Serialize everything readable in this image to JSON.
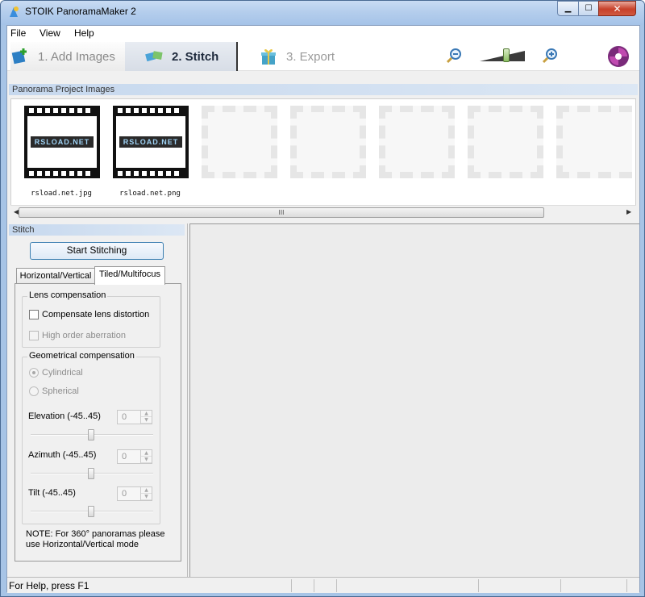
{
  "window": {
    "title": "STOIK PanoramaMaker 2",
    "min_icon": "minimize-icon",
    "max_icon": "maximize-icon",
    "close_icon": "close-icon"
  },
  "menu": [
    {
      "label": "File"
    },
    {
      "label": "View"
    },
    {
      "label": "Help"
    }
  ],
  "steps": [
    {
      "label": "1. Add Images",
      "icon": "add-images-icon",
      "state": "inactive"
    },
    {
      "label": "2. Stitch",
      "icon": "stitch-icon",
      "state": "active"
    },
    {
      "label": "3. Export",
      "icon": "export-gift-icon",
      "state": "inactive"
    }
  ],
  "toolbar": {
    "zoom_out_icon": "zoom-out-icon",
    "zoom_in_icon": "zoom-in-icon",
    "zoom_level": 0.6,
    "logo_icon": "stoik-logo-icon"
  },
  "project_images": {
    "header": "Panorama Project Images",
    "images": [
      {
        "label": "rsload.net.jpg",
        "logo_text": "RSLOAD.NET"
      },
      {
        "label": "rsload.net.png",
        "logo_text": "RSLOAD.NET"
      }
    ],
    "empty_slots": 5,
    "scroll_grip": "III"
  },
  "stitch": {
    "header": "Stitch",
    "start_button": "Start Stitching",
    "tabs": [
      {
        "label": "Horizontal/Vertical",
        "active": false
      },
      {
        "label": "Tiled/Multifocus",
        "active": true
      }
    ],
    "lens": {
      "title": "Lens compensation",
      "compensate_distortion": {
        "label": "Compensate lens distortion",
        "checked": false,
        "enabled": true
      },
      "high_order": {
        "label": "High order aberration",
        "checked": false,
        "enabled": false
      }
    },
    "geo": {
      "title": "Geometrical compensation",
      "cylindrical": {
        "label": "Cylindrical",
        "selected": true,
        "enabled": false
      },
      "spherical": {
        "label": "Spherical",
        "selected": false,
        "enabled": false
      },
      "elevation": {
        "label": "Elevation (-45..45)",
        "value": "0"
      },
      "azimuth": {
        "label": "Azimuth (-45..45)",
        "value": "0"
      },
      "tilt": {
        "label": "Tilt (-45..45)",
        "value": "0"
      }
    },
    "note": "NOTE: For 360° panoramas please use Horizontal/Vertical mode"
  },
  "status": {
    "text": "For Help, press F1"
  }
}
